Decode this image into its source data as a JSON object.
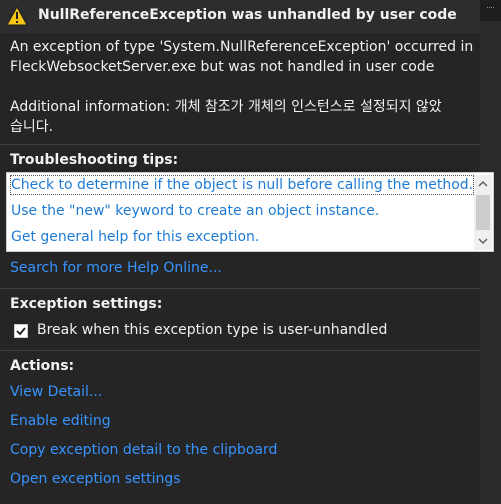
{
  "dialog": {
    "title": "NullReferenceException was unhandled by user code",
    "title_icon": "warning-icon",
    "close_icon": "close-icon"
  },
  "message": {
    "line1": "An exception of type 'System.NullReferenceException' occurred in",
    "line2": "FleckWebsocketServer.exe but was not handled in user code",
    "line3": "Additional information: 개체 참조가 개체의 인스턴스로 설정되지 않았",
    "line4": "습니다."
  },
  "troubleshooting": {
    "heading": "Troubleshooting tips:",
    "tips": [
      "Check to determine if the object is null before calling the method.",
      "Use the \"new\" keyword to create an object instance.",
      "Get general help for this exception."
    ],
    "search_link": "Search for more Help Online..."
  },
  "exception_settings": {
    "heading": "Exception settings:",
    "break_label": "Break when this exception type is user-unhandled",
    "break_checked": true
  },
  "actions": {
    "heading": "Actions:",
    "items": [
      "View Detail...",
      "Enable editing",
      "Copy exception detail to the clipboard",
      "Open exception settings"
    ]
  },
  "colors": {
    "background": "#252526",
    "link": "#3794ff",
    "tip_link": "#1e7bd3",
    "warning": "#f5c518"
  }
}
